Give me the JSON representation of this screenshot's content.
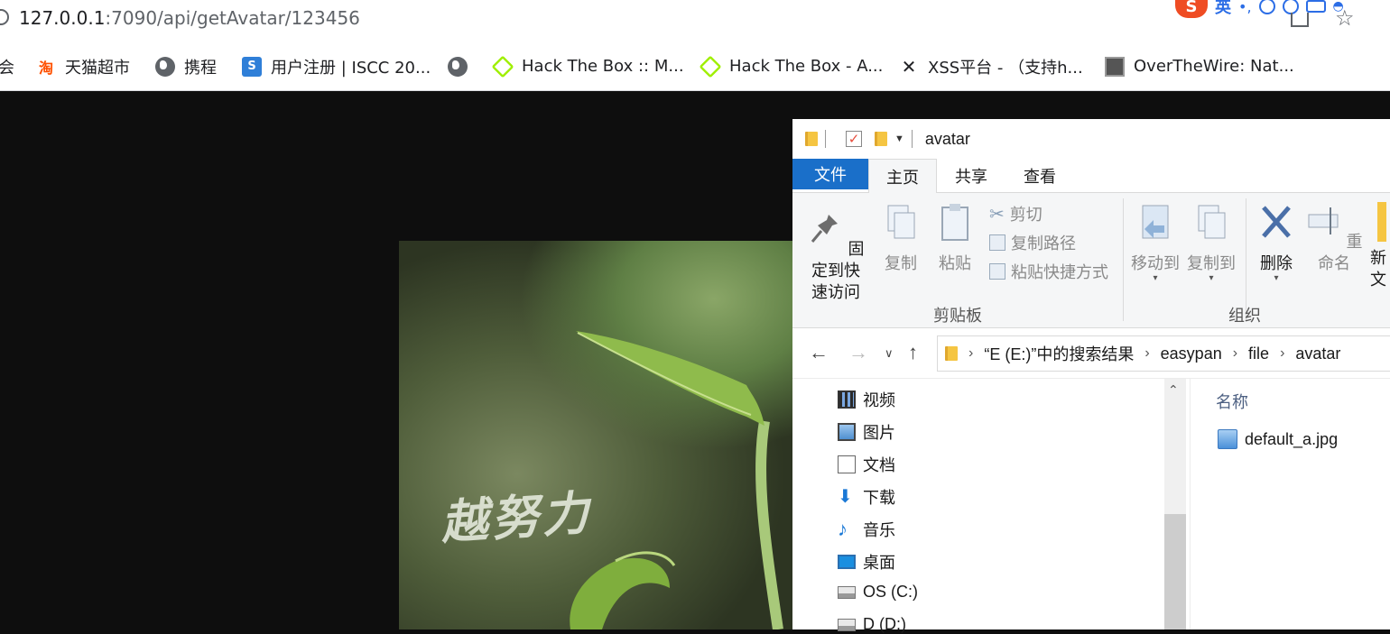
{
  "browser": {
    "url_host": "127.0.0.1",
    "url_rest": ":7090/api/getAvatar/123456",
    "ime": {
      "logo": "S",
      "lang": "英"
    },
    "bookmarks": [
      {
        "label": "会",
        "icon": "none"
      },
      {
        "label": "天猫超市",
        "icon": "taobao-icon"
      },
      {
        "label": "携程",
        "icon": "globe-icon"
      },
      {
        "label": "用户注册 | ISCC 20...",
        "icon": "iscc-icon"
      },
      {
        "label": "",
        "icon": "globe-icon"
      },
      {
        "label": "Hack The Box :: M...",
        "icon": "hackthebox-icon"
      },
      {
        "label": "Hack The Box - A...",
        "icon": "hackthebox-icon"
      },
      {
        "label": "XSS平台 - （支持h...",
        "icon": "xss-icon"
      },
      {
        "label": "OverTheWire: Nat...",
        "icon": "overthewire-icon"
      }
    ]
  },
  "viewer": {
    "image_caption": "越努力"
  },
  "explorer": {
    "window_title": "avatar",
    "tabs": [
      "文件",
      "主页",
      "共享",
      "查看"
    ],
    "ribbon": {
      "pin_label_line1": "固定到快",
      "pin_label_line2": "速访问",
      "copy": "复制",
      "paste": "粘贴",
      "cut": "剪切",
      "copy_path": "复制路径",
      "paste_shortcut": "粘贴快捷方式",
      "clipboard_group": "剪贴板",
      "move_to": "移动到",
      "copy_to": "复制到",
      "delete": "删除",
      "rename": "重命名",
      "new_partial_line1": "新",
      "new_partial_line2": "文",
      "organize_group": "组织"
    },
    "breadcrumb": [
      "“E (E:)”中的搜索结果",
      "easypan",
      "file",
      "avatar"
    ],
    "nav_items": [
      {
        "label": "视频",
        "icon": "video-icon"
      },
      {
        "label": "图片",
        "icon": "pictures-icon"
      },
      {
        "label": "文档",
        "icon": "documents-icon"
      },
      {
        "label": "下载",
        "icon": "downloads-icon"
      },
      {
        "label": "音乐",
        "icon": "music-icon"
      },
      {
        "label": "桌面",
        "icon": "desktop-icon"
      },
      {
        "label": "OS (C:)",
        "icon": "drive-icon"
      },
      {
        "label": "D (D:)",
        "icon": "drive-icon"
      }
    ],
    "column_name": "名称",
    "files": [
      {
        "name": "default_a.jpg",
        "icon": "image-file-icon"
      }
    ]
  },
  "colors": {
    "file_tab": "#1a6fc9",
    "page_background": "#0e0e0e"
  }
}
